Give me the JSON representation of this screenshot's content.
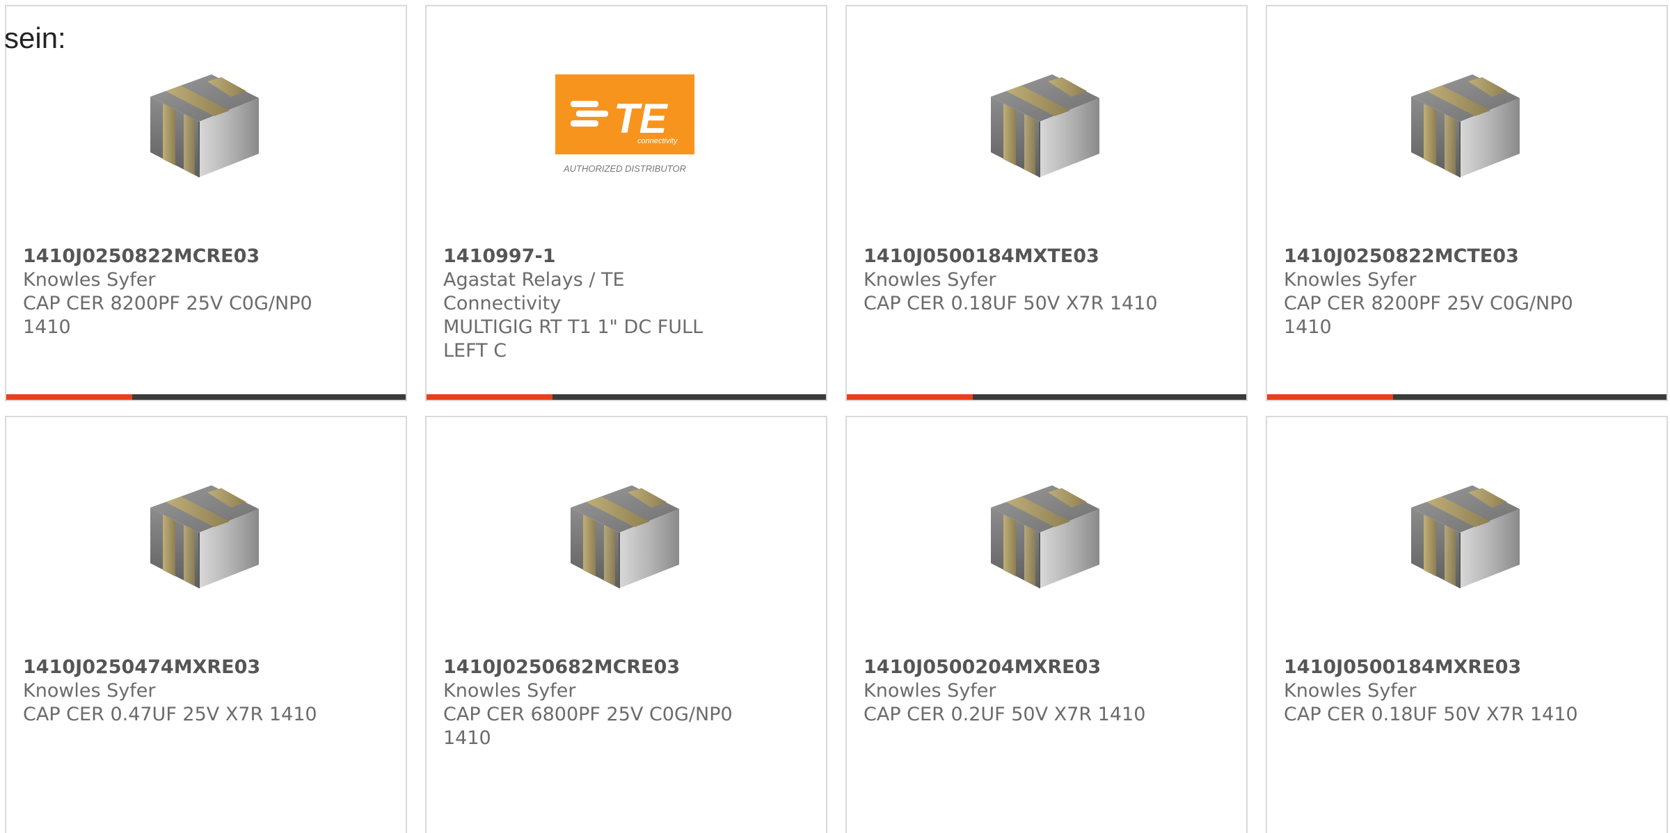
{
  "heading": "sein:",
  "colors": {
    "accent_bar": "#e8401c",
    "bar_track": "#3b3b3b",
    "te_logo_orange": "#f7941d"
  },
  "products": [
    {
      "part_number": "1410J0250822MCRE03",
      "manufacturer": "Knowles Syfer",
      "description": "CAP CER 8200PF 25V C0G/NP0 1410",
      "image": "capacitor-chip-icon",
      "progress_fraction": 0.315
    },
    {
      "part_number": "1410997-1",
      "manufacturer": "Agastat Relays / TE Connectivity",
      "description": "MULTIGIG RT T1 1\" DC FULL LEFT C",
      "image": "te-connectivity-logo",
      "logo_text": "TE",
      "logo_subtext": "connectivity",
      "logo_caption": "AUTHORIZED DISTRIBUTOR",
      "progress_fraction": 0.315
    },
    {
      "part_number": "1410J0500184MXTE03",
      "manufacturer": "Knowles Syfer",
      "description": "CAP CER 0.18UF 50V X7R 1410",
      "image": "capacitor-chip-icon",
      "progress_fraction": 0.315
    },
    {
      "part_number": "1410J0250822MCTE03",
      "manufacturer": "Knowles Syfer",
      "description": "CAP CER 8200PF 25V C0G/NP0 1410",
      "image": "capacitor-chip-icon",
      "progress_fraction": 0.315
    },
    {
      "part_number": "1410J0250474MXRE03",
      "manufacturer": "Knowles Syfer",
      "description": "CAP CER 0.47UF 25V X7R 1410",
      "image": "capacitor-chip-icon"
    },
    {
      "part_number": "1410J0250682MCRE03",
      "manufacturer": "Knowles Syfer",
      "description": "CAP CER 6800PF 25V C0G/NP0 1410",
      "image": "capacitor-chip-icon"
    },
    {
      "part_number": "1410J0500204MXRE03",
      "manufacturer": "Knowles Syfer",
      "description": "CAP CER 0.2UF 50V X7R 1410",
      "image": "capacitor-chip-icon"
    },
    {
      "part_number": "1410J0500184MXRE03",
      "manufacturer": "Knowles Syfer",
      "description": "CAP CER 0.18UF 50V X7R 1410",
      "image": "capacitor-chip-icon"
    }
  ]
}
